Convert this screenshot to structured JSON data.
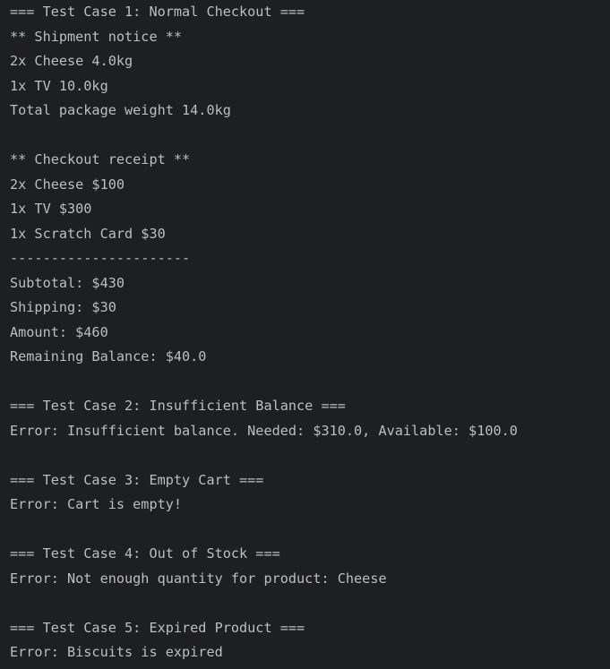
{
  "console": {
    "lines": [
      "=== Test Case 1: Normal Checkout ===",
      "** Shipment notice **",
      "2x Cheese 4.0kg",
      "1x TV 10.0kg",
      "Total package weight 14.0kg",
      "",
      "** Checkout receipt **",
      "2x Cheese $100",
      "1x TV $300",
      "1x Scratch Card $30",
      "----------------------",
      "Subtotal: $430",
      "Shipping: $30",
      "Amount: $460",
      "Remaining Balance: $40.0",
      "",
      "=== Test Case 2: Insufficient Balance ===",
      "Error: Insufficient balance. Needed: $310.0, Available: $100.0",
      "",
      "=== Test Case 3: Empty Cart ===",
      "Error: Cart is empty!",
      "",
      "=== Test Case 4: Out of Stock ===",
      "Error: Not enough quantity for product: Cheese",
      "",
      "=== Test Case 5: Expired Product ===",
      "Error: Biscuits is expired"
    ]
  }
}
